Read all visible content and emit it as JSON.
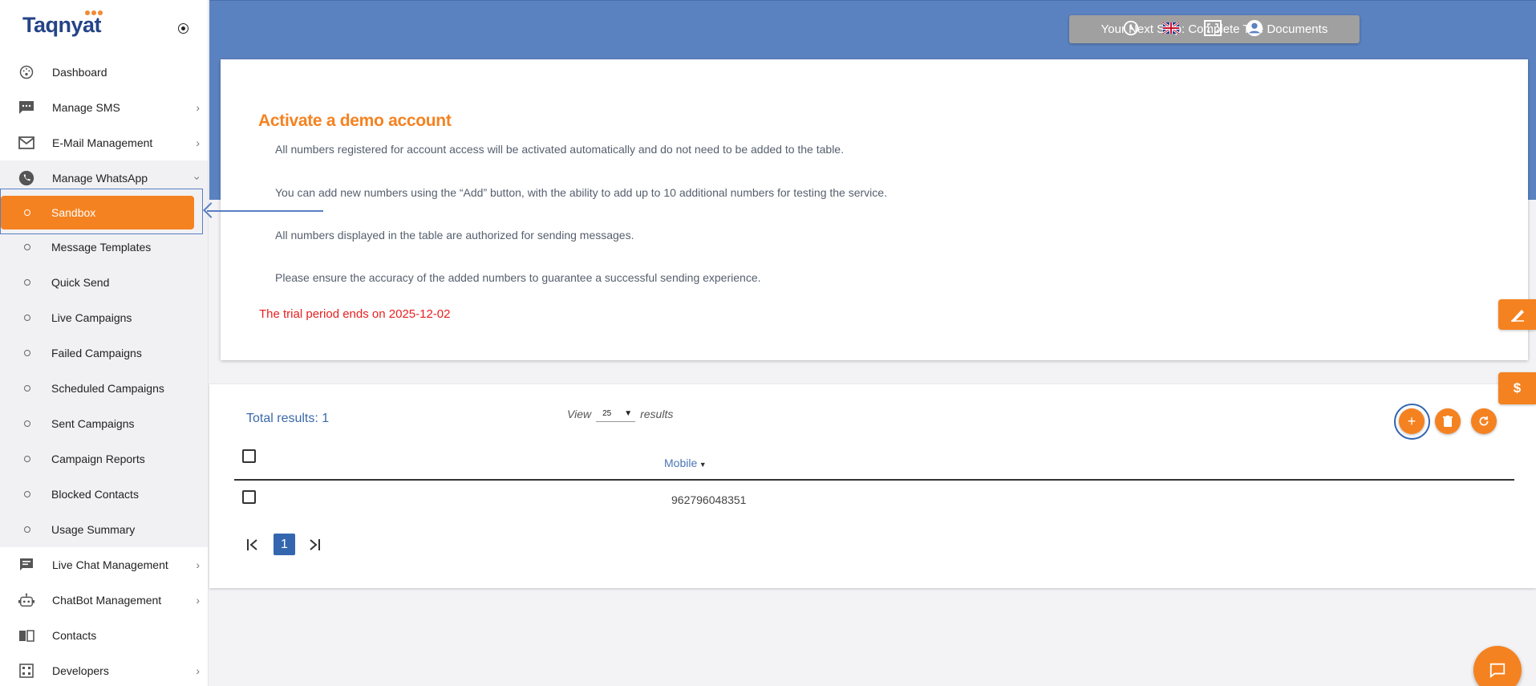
{
  "brand": {
    "logo_text": "Taqnyat"
  },
  "topbar": {
    "next_step_label": "Your Next Step: Complete The Documents",
    "icons": [
      "history-icon",
      "uk-flag-icon",
      "fullscreen-icon",
      "account-icon"
    ]
  },
  "sidebar": {
    "items": [
      {
        "label": "Dashboard",
        "icon": "dashboard-icon"
      },
      {
        "label": "Manage SMS",
        "icon": "sms-icon"
      },
      {
        "label": "E-Mail Management",
        "icon": "mail-icon"
      },
      {
        "label": "Manage WhatsApp",
        "icon": "whatsapp-icon"
      }
    ],
    "whatsapp_sub": [
      {
        "label": "Sandbox"
      },
      {
        "label": "Message Templates"
      },
      {
        "label": "Quick Send"
      },
      {
        "label": "Live Campaigns"
      },
      {
        "label": "Failed Campaigns"
      },
      {
        "label": "Scheduled Campaigns"
      },
      {
        "label": "Sent Campaigns"
      },
      {
        "label": "Campaign Reports"
      },
      {
        "label": "Blocked Contacts"
      },
      {
        "label": "Usage Summary"
      }
    ],
    "items_after": [
      {
        "label": "Live Chat Management",
        "icon": "chat-icon"
      },
      {
        "label": "ChatBot Management",
        "icon": "robot-icon"
      },
      {
        "label": "Contacts",
        "icon": "contacts-book-icon"
      },
      {
        "label": "Developers",
        "icon": "developers-icon"
      }
    ]
  },
  "info_card": {
    "title": "Activate a demo account",
    "lines": [
      "All numbers registered for account access will be activated automatically and do not need to be added to the table.",
      "You can add new numbers using the “Add” button, with the ability to add up to 10 additional numbers for testing the service.",
      "All numbers displayed in the table are authorized for sending messages.",
      "Please ensure the accuracy of the added numbers to guarantee a successful sending experience."
    ],
    "trial_text": "The trial period ends on 2025-12-02"
  },
  "table": {
    "total_results": "Total results: 1",
    "view_label": "View",
    "view_value": "25",
    "results_label": "results",
    "columns": [
      "Mobile"
    ],
    "rows": [
      {
        "mobile": "962796048351"
      }
    ],
    "current_page": "1"
  },
  "side_tabs": {
    "dollar_label": "$"
  },
  "colors": {
    "accent": "#f58220",
    "topbar": "#5b82c0",
    "link": "#3a6aa8",
    "trial": "#e82020"
  }
}
